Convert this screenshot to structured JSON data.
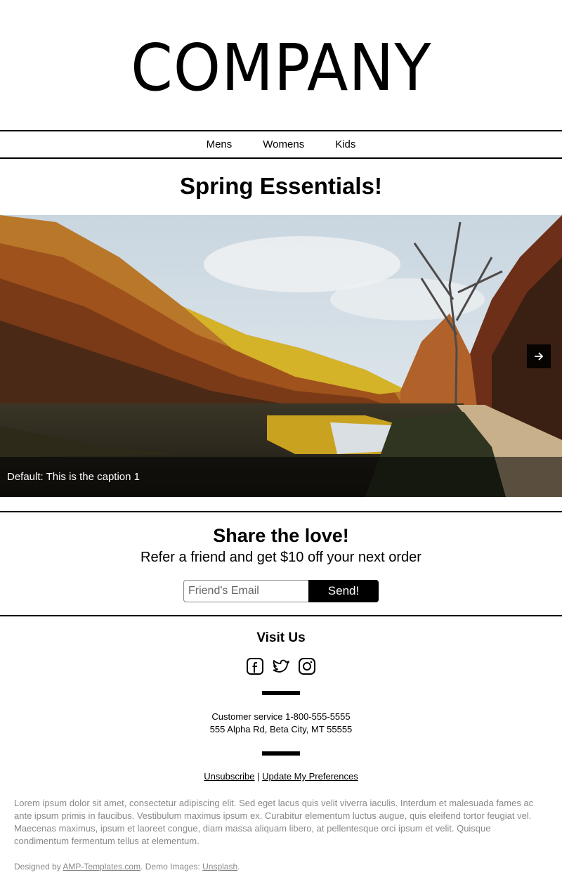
{
  "header": {
    "logo_text": "COMPANY"
  },
  "nav": {
    "items": [
      {
        "label": "Mens"
      },
      {
        "label": "Womens"
      },
      {
        "label": "Kids"
      }
    ]
  },
  "hero": {
    "title": "Spring Essentials!"
  },
  "carousel": {
    "caption": "Default: This is the caption 1",
    "next_icon": "arrow-right-icon"
  },
  "share": {
    "title": "Share the love!",
    "subtitle": "Refer a friend and get $10 off your next order",
    "email_placeholder": "Friend's Email",
    "send_label": "Send!"
  },
  "footer": {
    "visit_title": "Visit Us",
    "social_icons": [
      "facebook-icon",
      "twitter-icon",
      "instagram-icon"
    ],
    "customer_service": "Customer service 1-800-555-5555",
    "address": "555 Alpha Rd, Beta City, MT 55555",
    "unsubscribe_label": "Unsubscribe",
    "separator": " | ",
    "preferences_label": "Update My Preferences",
    "lorem": "Lorem ipsum dolor sit amet, consectetur adipiscing elit. Sed eget lacus quis velit viverra iaculis. Interdum et malesuada fames ac ante ipsum primis in faucibus. Vestibulum maximus ipsum ex. Curabitur elementum luctus augue, quis eleifend tortor feugiat vel. Maecenas maximus, ipsum et laoreet congue, diam massa aliquam libero, at pellentesque orci ipsum et velit. Quisque condimentum fermentum tellus at elementum.",
    "credits_prefix": "Designed by ",
    "credits_link1": "AMP-Templates.com",
    "credits_middle": ". Demo Images: ",
    "credits_link2": "Unsplash",
    "credits_suffix": "."
  }
}
